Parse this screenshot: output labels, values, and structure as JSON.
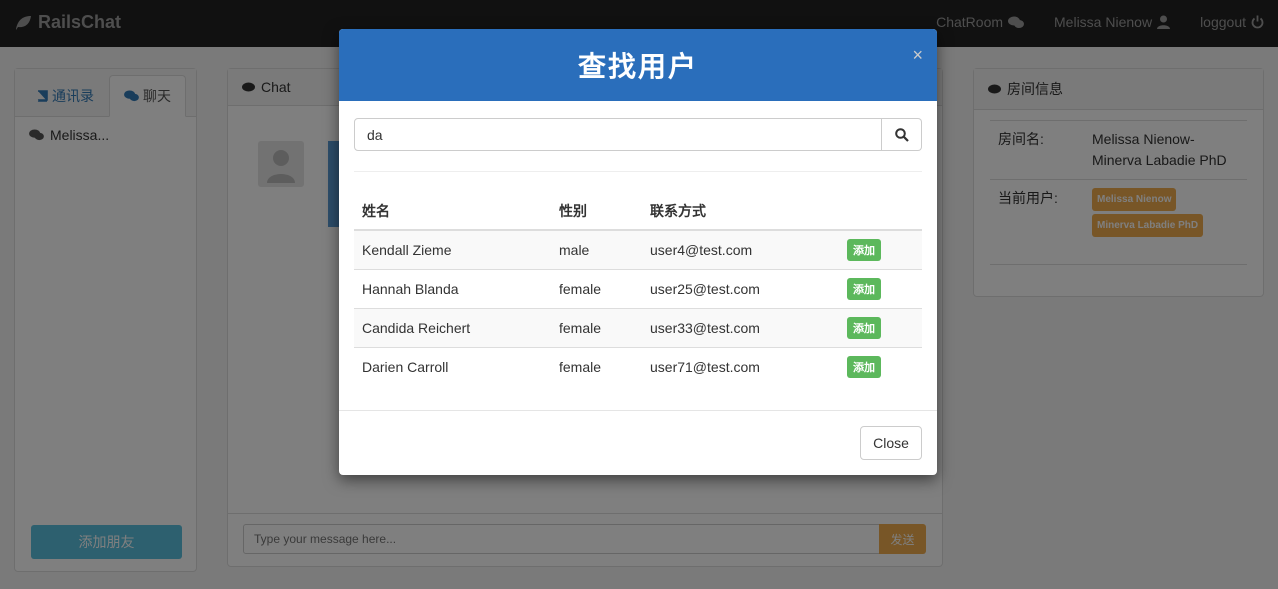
{
  "navbar": {
    "brand": "RailsChat",
    "links": [
      {
        "label": "ChatRoom",
        "icon": "comments-icon"
      },
      {
        "label": "Melissa Nienow",
        "icon": "user-icon"
      },
      {
        "label": "loggout",
        "icon": "power-icon"
      }
    ]
  },
  "left_panel": {
    "tabs": [
      {
        "label": "通讯录",
        "icon": "book-icon"
      },
      {
        "label": "聊天",
        "icon": "comments-icon"
      }
    ],
    "contacts": [
      {
        "label": "Melissa...",
        "icon": "comments-icon"
      }
    ],
    "add_friend_label": "添加朋友"
  },
  "chat_panel": {
    "heading": "Chat",
    "input_placeholder": "Type your message here...",
    "send_label": "发送"
  },
  "room_panel": {
    "heading": "房间信息",
    "room_name_label": "房间名:",
    "room_name_value": "Melissa Nienow-Minerva Labadie PhD",
    "current_users_label": "当前用户:",
    "current_users": [
      "Melissa Nienow",
      "Minerva Labadie PhD"
    ]
  },
  "modal": {
    "title": "查找用户",
    "close_x": "×",
    "search_value": "da",
    "columns": [
      "姓名",
      "性别",
      "联系方式",
      ""
    ],
    "rows": [
      {
        "name": "Kendall Zieme",
        "gender": "male",
        "contact": "user4@test.com",
        "action": "添加"
      },
      {
        "name": "Hannah Blanda",
        "gender": "female",
        "contact": "user25@test.com",
        "action": "添加"
      },
      {
        "name": "Candida Reichert",
        "gender": "female",
        "contact": "user33@test.com",
        "action": "添加"
      },
      {
        "name": "Darien Carroll",
        "gender": "female",
        "contact": "user71@test.com",
        "action": "添加"
      }
    ],
    "close_label": "Close"
  },
  "colors": {
    "navbar": "#222222",
    "modal_header": "#2a6ebb",
    "add_button": "#5cb85c",
    "send_button": "#f0ad4e",
    "badge": "#f0ad4e",
    "add_friend": "#5bc0de"
  }
}
